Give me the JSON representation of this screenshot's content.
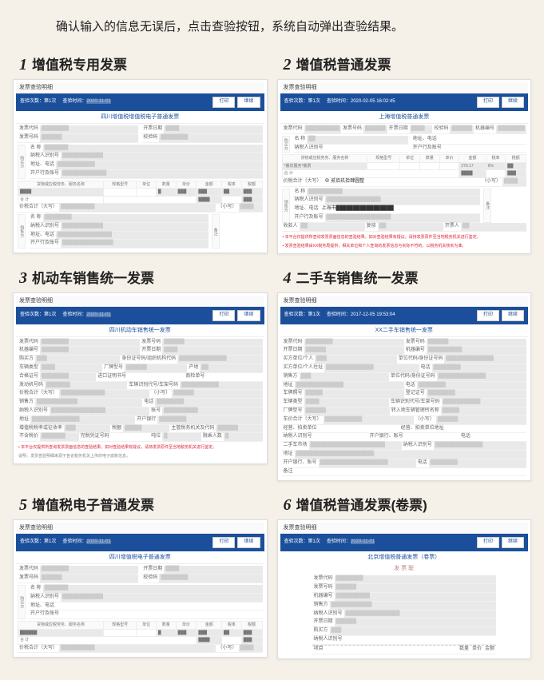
{
  "intro": "确认输入的信息无误后，点击查验按钮，系统自动弹出查验结果。",
  "cards": {
    "c1": {
      "num": "1",
      "title": "增值税专用发票"
    },
    "c2": {
      "num": "2",
      "title": "增值税普通发票"
    },
    "c3": {
      "num": "3",
      "title": "机动车销售统一发票"
    },
    "c4": {
      "num": "4",
      "title": "二手车销售统一发票"
    },
    "c5": {
      "num": "5",
      "title": "增值税电子普通发票"
    },
    "c6": {
      "num": "6",
      "title": "增值税普通发票(卷票)"
    }
  },
  "panel": {
    "title": "发票查验明细",
    "check_count_label": "查验次数：",
    "check_count_value": "第1次",
    "check_time_label": "查验时间：",
    "check_time_value_1": "2020-11-01",
    "check_time_value_2a": "2020-02-05 16:02:45",
    "check_time_value_4": "2017-12-05 19:53:04",
    "btn_print": "打印",
    "btn_continue": "继续",
    "form_title_1": "四川增值税增值税电子普通发票",
    "form_title_2": "上海增值税普通发票",
    "form_title_3": "四川机动车销售统一发票",
    "form_title_4": "XX二手车销售统一发票",
    "form_title_5": "四川增值税电子普通发票",
    "form_title_6": "北京增值税普通发票（卷票）",
    "tag6": "发 票 联"
  },
  "fields": {
    "fpdm": "发票代码",
    "fphm": "发票号码",
    "kprq": "开票日期",
    "jym": "校验码",
    "jqbh": "机器编号",
    "gmf": "购买方",
    "xsf": "销售方",
    "mc": "名 称",
    "nsrsbh": "纳税人识别号",
    "dzdh": "地址、电话",
    "khhzh": "开户行及账号",
    "hwmc": "货物或应税劳务、服务名称",
    "ggxh": "规格型号",
    "dw": "单位",
    "sl": "数量",
    "dj": "单价",
    "je": "金额",
    "slv": "税率",
    "se": "税额",
    "hj": "合 计",
    "jshj": "价税合计（大写）",
    "xx": "（小写）",
    "bz": "备注",
    "skr": "收款人",
    "fh": "复核",
    "kpr": "开票人",
    "jdc_sfz": "身份证号码/组织机构代码",
    "jdc_cllx": "车辆类型",
    "jdc_cpxh": "厂牌型号",
    "jdc_cd": "产地",
    "jdc_hgzh": "合格证号",
    "jdc_jksm": "进口证明书号",
    "jdc_sjdh": "商检单号",
    "jdc_fdjhm": "发动机号码",
    "jdc_cjhm": "车辆识别代号/车架号码",
    "jdc_dh": "电话",
    "jdc_zh": "账号",
    "jdc_dz": "地址",
    "jdc_khyh": "开户银行",
    "jdc_zzs": "增值税税率或征收率",
    "jdc_zgsw": "主管税务机关及代码",
    "jdc_bhsj": "不含税价",
    "jdc_wspzh": "完税凭证号码",
    "jdc_dw": "吨位",
    "jdc_xcrs": "限乘人数",
    "es_mf": "买 方",
    "es_mf_dwgr": "买方单位/个人",
    "es_mf_dwdm": "单位代码/身份证号码",
    "es_mf_dz": "买方单位/个人住址",
    "es_cph": "车牌照号",
    "es_djzh": "登记证号",
    "es_cgs": "转入地车辆管理所名称",
    "es_cjhj": "车价合计（大写）",
    "es_sc": "经营、拍卖单位",
    "es_sc_mc": "经营、拍卖单位",
    "es_sc_dz": "经营、拍卖单位地址",
    "es_esc": "二手车市场",
    "es_khyh": "开户银行、账号",
    "j6_xm": "项目",
    "j6_je": "金额"
  },
  "notes": {
    "red1": "• 本平台仅提供所查询发票票面信息的查验结果。如对查验结果有疑议，请持发票原件至当地税务机关进行鉴定。",
    "red2": "• 发票查验结果由XX税务局提供，相关单位和个人查询的发票信息与实际不符的，以税务机关核实为准。",
    "grey": "说明：发票查验明细来源于各省税务机关上传的电子底账信息。"
  }
}
